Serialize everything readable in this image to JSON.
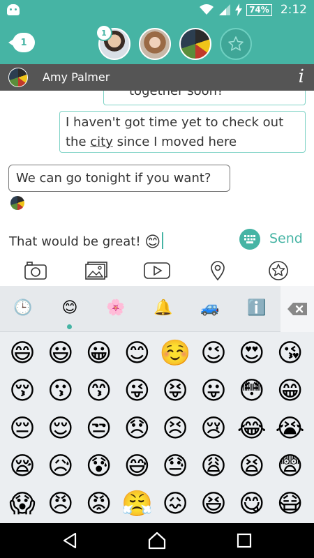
{
  "status_bar": {
    "battery": "74%",
    "time": "2:12"
  },
  "header": {
    "back_badge": "1",
    "unread_badge": "1",
    "avatars": [
      "contact-man",
      "contact-woman",
      "contact-amy"
    ]
  },
  "contact": {
    "name": "Amy Palmer",
    "info_icon": "i"
  },
  "messages": {
    "prev_partial": "together soon?",
    "sent_1_part1": "I haven't got time yet to check out",
    "sent_1_part2a": "the ",
    "sent_1_link": "city",
    "sent_1_part2b": " since I moved here",
    "received_1": "We can go tonight if you want?"
  },
  "composer": {
    "text": "That would be great! ",
    "emoji": "😊",
    "send_label": "Send"
  },
  "toolbar": {
    "icons": [
      "camera-icon",
      "image-icon",
      "video-icon",
      "location-icon",
      "star-icon"
    ]
  },
  "emoji_tabs": [
    "🕒",
    "😊",
    "🌸",
    "🔔",
    "🚙",
    "ℹ️"
  ],
  "emoji_rows": [
    [
      "😄",
      "😃",
      "😀",
      "😊",
      "☺️",
      "😉",
      "😍",
      "😘"
    ],
    [
      "😚",
      "😗",
      "😙",
      "😜",
      "😝",
      "😛",
      "😳",
      "😁"
    ],
    [
      "😔",
      "😌",
      "😒",
      "😞",
      "😣",
      "😢",
      "😂",
      "😭"
    ],
    [
      "😪",
      "😥",
      "😰",
      "😅",
      "😓",
      "😩",
      "😫",
      "😨"
    ],
    [
      "😱",
      "😠",
      "😡",
      "😤",
      "😖",
      "😆",
      "😋",
      "😷"
    ]
  ],
  "colors": {
    "accent": "#46b4a4",
    "contact_bar": "#555555",
    "panel": "#ebeef1"
  }
}
